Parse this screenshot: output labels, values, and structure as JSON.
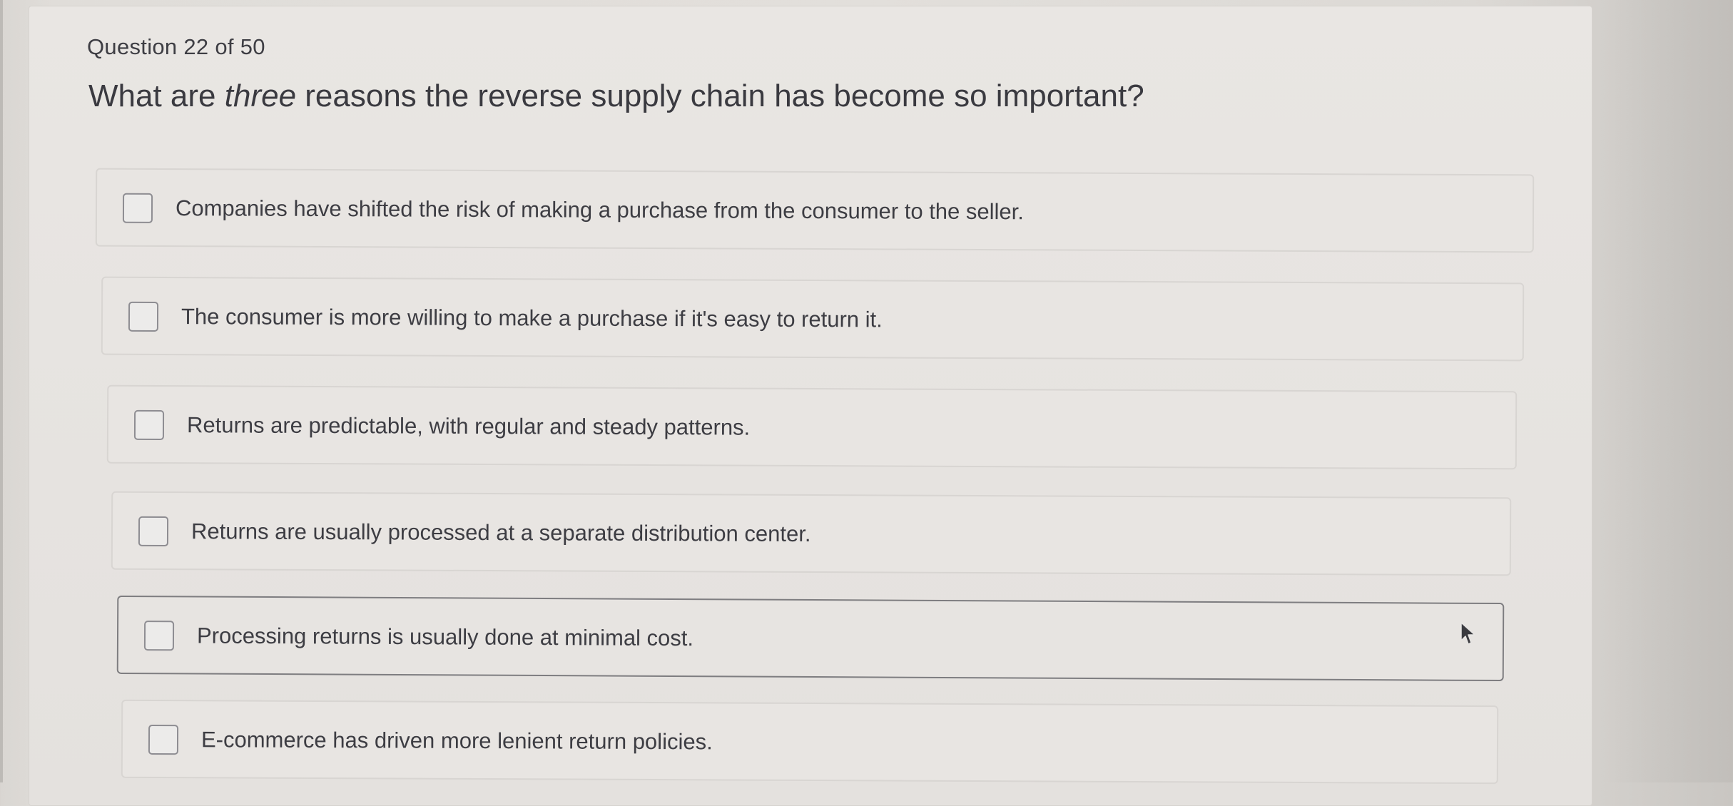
{
  "quiz": {
    "counter": "Question 22 of 50",
    "question_prefix": "What are ",
    "question_emphasis": "three",
    "question_suffix": " reasons the reverse supply chain has become so important?"
  },
  "options": [
    {
      "label": "Companies have shifted the risk of making a purchase from the consumer to the seller.",
      "checked": false
    },
    {
      "label": "The consumer is more willing to make a purchase if it's easy to return it.",
      "checked": false
    },
    {
      "label": "Returns are predictable, with regular and steady patterns.",
      "checked": false
    },
    {
      "label": "Returns are usually processed at a separate distribution center.",
      "checked": false
    },
    {
      "label": "Processing returns is usually done at minimal cost.",
      "checked": false
    },
    {
      "label": "E-commerce has driven more lenient return policies.",
      "checked": false
    }
  ],
  "icons": {
    "checkbox": "checkbox-icon",
    "cursor": "mouse-pointer-icon"
  },
  "colors": {
    "text": "#3a3a40",
    "checkbox_border": "#8e8d92",
    "hover_border": "#7e7d80"
  }
}
